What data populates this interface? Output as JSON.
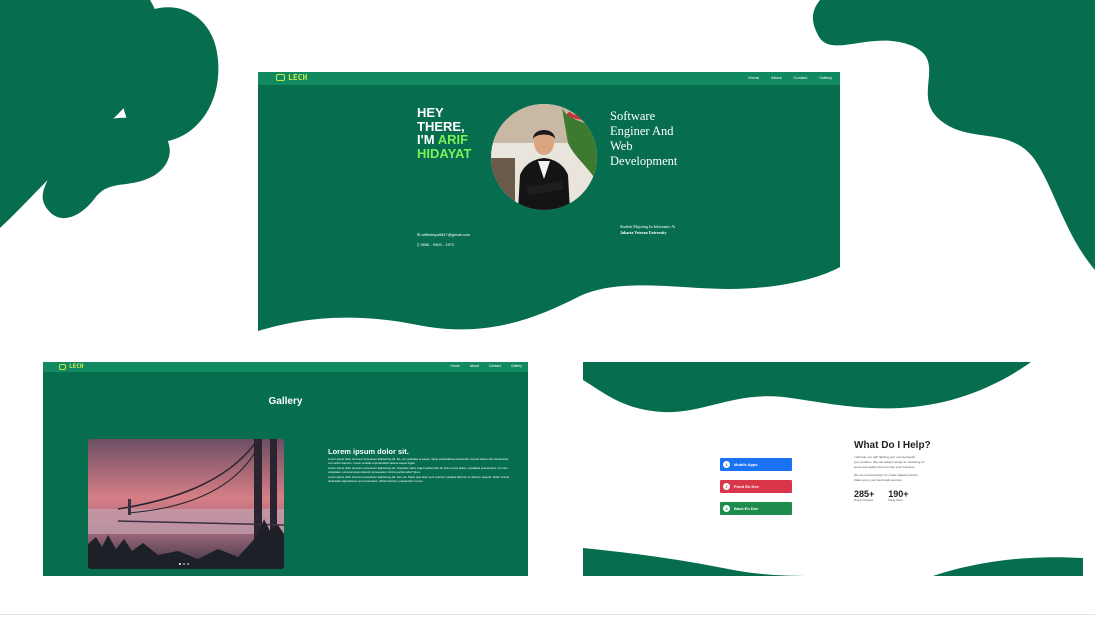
{
  "colors": {
    "brand_green": "#066e4e",
    "nav_green": "#118a61",
    "accent_lime": "#7cf05a",
    "mobile_blue": "#1a73f5",
    "front_red": "#d9364a",
    "back_green": "#1e8c4a"
  },
  "brand": {
    "logo_text": "LECH"
  },
  "nav": {
    "items": [
      "Home",
      "About",
      "Contact",
      "Gallery"
    ]
  },
  "hero": {
    "greeting_line1": "HEY",
    "greeting_line2": "THERE,",
    "im": "I'M",
    "first_name": "ARIF",
    "last_name": "HIDAYAT",
    "role_line1": "Software",
    "role_line2": "Enginer And",
    "role_line3": "Web",
    "role_line4": "Development",
    "email": "arifhidaya0847@gmail.com",
    "phone": "0856 - 9309 - 1972",
    "student_line": "Student Majoring In Informatic At",
    "university": "Jakarta Veteran University"
  },
  "gallery": {
    "title": "Gallery",
    "heading": "Lorem ipsum dolor sit.",
    "para1": "Lorem ipsum dolor sit amet consectetur adipisicing elit. Illo, vel molestiae et eaque. Quas voluptatibus perferendis corporis dolore sint consectetur, cum animi dolorum. Lorem veritatis reprehenderit ratione eaque fugiat.",
    "para2": "Lorem ipsum dolor sit amet consectetur adipisicing elit. Voluptate natus magni perferendis at! Iusto omnis dolore, cupiditate praesentium. Ut enim voluptates, vel amet quam deleniti consequatur minima perferendis? Quos.",
    "para3": "Lorem ipsum dolor sit amet consectetur adipisicing elit. Sed, ad. Nobis quis dolor sunt nostrum voluptas laborum et dolorum quaerat. Nulla minima quibusdam dignissimos eos consectetur, officiis dolorem, praesentium rerum."
  },
  "help": {
    "title": "What Do I Help?",
    "desc1": "I will help you with fighting your own demands",
    "desc2": "your problem. We can always design to marketing for",
    "desc3": "prove and quality that can help your business.",
    "desc4": "We are trusted design for create digital products",
    "desc5": "Make some your best track success.",
    "services": [
      {
        "num": "1",
        "label": "Mobile Apps"
      },
      {
        "num": "2",
        "label": "Front En Dev"
      },
      {
        "num": "3",
        "label": "Back En Dev"
      }
    ],
    "stat1_value": "285+",
    "stat1_label": "Project Complete",
    "stat2_value": "190+",
    "stat2_label": "Happy Client"
  }
}
